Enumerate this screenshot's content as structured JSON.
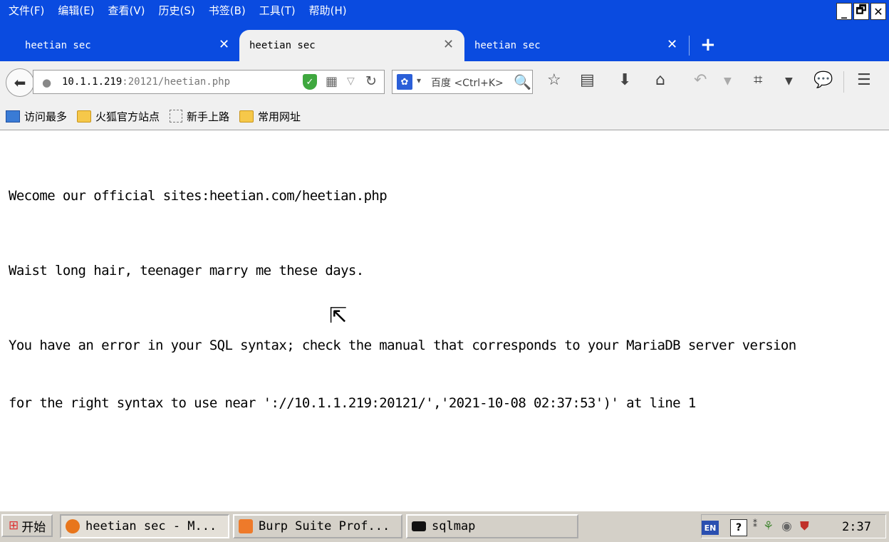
{
  "menu": [
    "文件(F)",
    "编辑(E)",
    "查看(V)",
    "历史(S)",
    "书签(B)",
    "工具(T)",
    "帮助(H)"
  ],
  "window_controls": {
    "minimize": "_",
    "restore": "🗗",
    "close": "✕"
  },
  "tabs": [
    {
      "label": "heetian sec",
      "close": "✕",
      "active": false
    },
    {
      "label": "heetian sec",
      "close": "✕",
      "active": true
    },
    {
      "label": "heetian sec",
      "close": "✕",
      "active": false
    }
  ],
  "new_tab": "+",
  "navbar": {
    "url_host": "10.1.1.219",
    "url_rest": ":20121/heetian.php",
    "search_placeholder": "百度 <Ctrl+K>"
  },
  "bookmarks": [
    {
      "label": "访问最多",
      "icon": "most-visited-icon"
    },
    {
      "label": "火狐官方站点",
      "icon": "folder-icon"
    },
    {
      "label": "新手上路",
      "icon": "dashed-box-icon"
    },
    {
      "label": "常用网址",
      "icon": "folder-icon"
    }
  ],
  "content": {
    "line1": "Wecome our official sites:heetian.com/heetian.php",
    "line2": "Waist long hair, teenager marry me these days.",
    "line3": "You have an error in your SQL syntax; check the manual that corresponds to your MariaDB server version",
    "line4": "for the right syntax to use near '://10.1.1.219:20121/','2021-10-08 02:37:53')' at line 1"
  },
  "taskbar": {
    "start": "开始",
    "tasks": [
      {
        "label": "heetian sec - M...",
        "icon": "firefox-icon",
        "color": "#e8761c"
      },
      {
        "label": "Burp Suite Prof...",
        "icon": "burp-icon",
        "color": "#ee7a2a"
      },
      {
        "label": "sqlmap",
        "icon": "cmd-icon",
        "color": "#111111"
      }
    ],
    "lang": "EN",
    "help": "?",
    "clock": "2:37"
  },
  "colors": {
    "titlebar": "#0a4be0",
    "chrome": "#f0f0f0",
    "taskbar": "#d4d0c8"
  }
}
